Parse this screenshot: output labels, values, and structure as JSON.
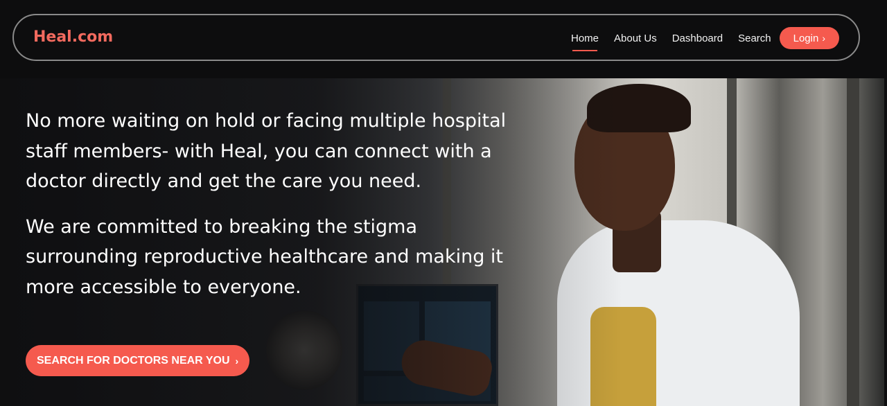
{
  "header": {
    "brand": "Heal.com",
    "nav": [
      {
        "label": "Home",
        "active": true
      },
      {
        "label": "About Us",
        "active": false
      },
      {
        "label": "Dashboard",
        "active": false
      },
      {
        "label": "Search",
        "active": false
      }
    ],
    "login_label": "Login",
    "login_icon": "chevron-right-icon"
  },
  "hero": {
    "paragraph_1": "No more waiting on hold or facing multiple hospital staff members- with Heal, you can connect with a doctor directly and get the care you need.",
    "paragraph_2": "We are committed to breaking the stigma surrounding reproductive healthcare and making it more accessible to everyone.",
    "cta_label": "SEARCH FOR DOCTORS NEAR YOU",
    "cta_icon": "chevron-right-icon"
  },
  "colors": {
    "accent": "#f55a4e",
    "brand": "#f26a5e",
    "background": "#0d0d0e"
  }
}
